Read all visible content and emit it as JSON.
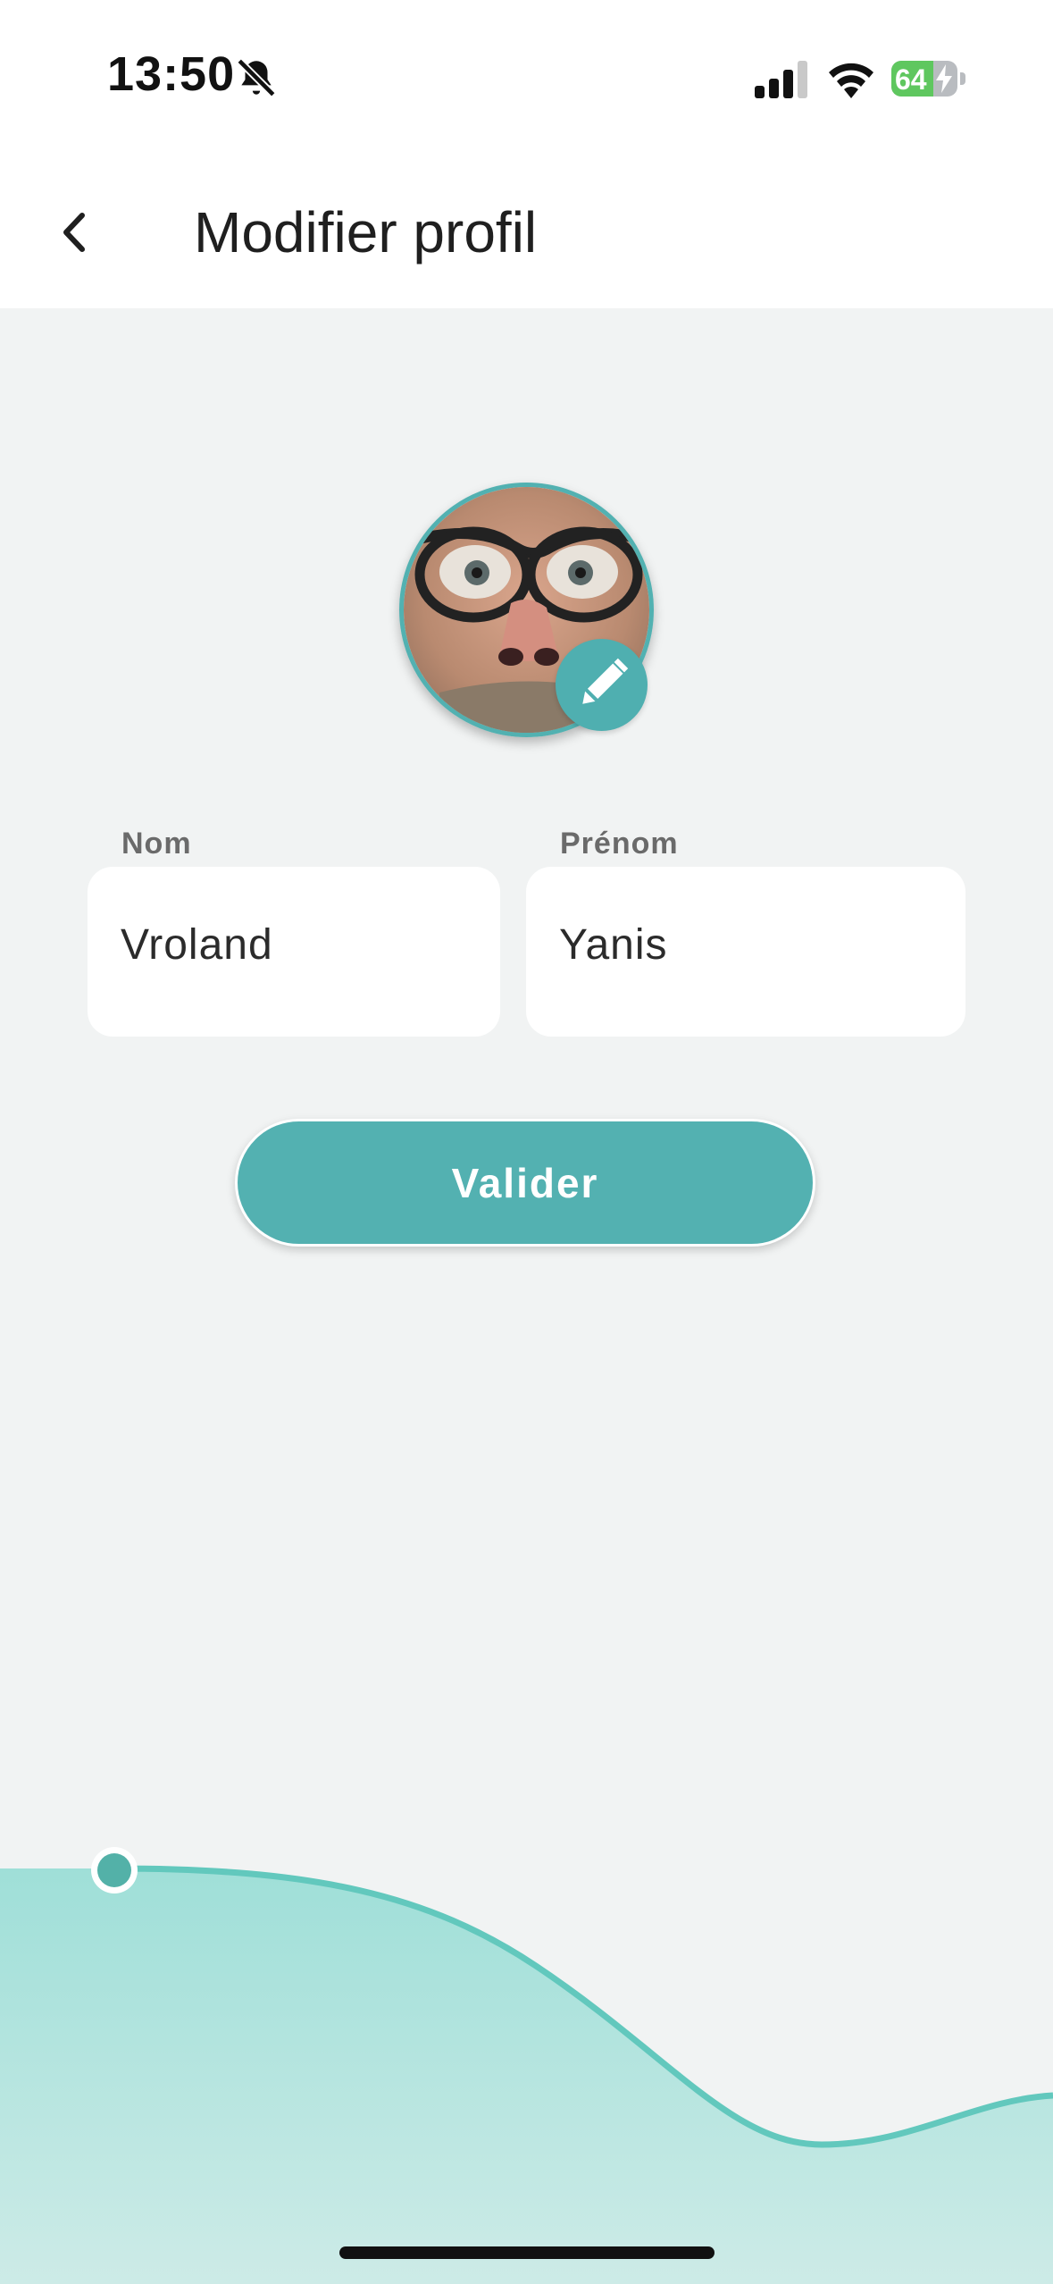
{
  "status_bar": {
    "time": "13:50",
    "battery_level": "64",
    "battery_percent": 64,
    "icons": [
      "bell-slash-icon",
      "cellular-signal-icon",
      "wifi-icon",
      "battery-charging-icon"
    ]
  },
  "header": {
    "title": "Modifier profil",
    "back_icon": "chevron-left-icon"
  },
  "avatar": {
    "edit_icon": "pencil-icon",
    "accent_color": "#52b1b1"
  },
  "form": {
    "nom": {
      "label": "Nom",
      "value": "Vroland"
    },
    "prenom": {
      "label": "Prénom",
      "value": "Yanis"
    }
  },
  "actions": {
    "submit_label": "Valider"
  },
  "colors": {
    "accent": "#53b1b1",
    "background": "#f1f3f3",
    "wave_top": "#9fdfd8",
    "wave_bottom": "#cdebe7"
  }
}
